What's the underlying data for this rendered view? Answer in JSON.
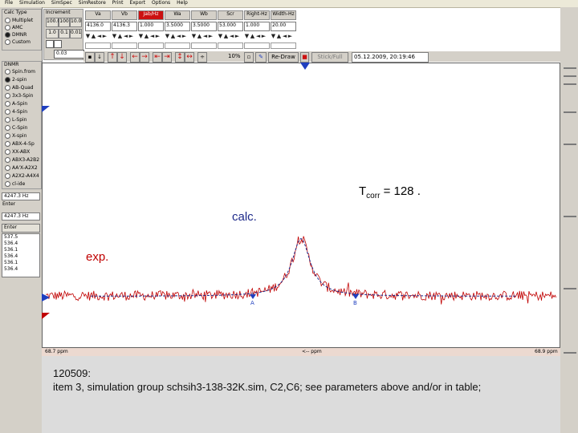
{
  "menu": [
    "File",
    "Simulation",
    "SimSpec",
    "SimRestore",
    "Print",
    "Export",
    "Options",
    "Help"
  ],
  "calc_type": {
    "title": "Calc Type",
    "options": [
      "Multiplet",
      "AMC",
      "DMNR",
      "Custom"
    ],
    "selected": "DMNR"
  },
  "increment": {
    "title": "Increment",
    "buttons": [
      "100.0",
      "100",
      "10.0",
      "1.0",
      "0.1",
      "0.01"
    ],
    "value": "0.03"
  },
  "params": [
    {
      "label": "Va",
      "value": "4136.0",
      "highlight": false
    },
    {
      "label": "Vb",
      "value": "4136.3",
      "highlight": false
    },
    {
      "label": "Jab/Hz",
      "value": "1.000",
      "highlight": true
    },
    {
      "label": "Wa",
      "value": "3.5000",
      "highlight": false
    },
    {
      "label": "Wb",
      "value": "3.5000",
      "highlight": false
    },
    {
      "label": "Scr",
      "value": "53.000",
      "highlight": false
    },
    {
      "label": "Right-Hz",
      "value": "1.000",
      "highlight": false
    },
    {
      "label": "Width-Hz",
      "value": "20.00",
      "highlight": false
    }
  ],
  "toolbar": {
    "zoom": "10%",
    "redraw": "Re-Draw",
    "stick_full": "Stick/Full",
    "timestamp": "05.12.2009, 20:19:46"
  },
  "dnmr": {
    "title": "DNMR",
    "options": [
      "Spin.from",
      "2-spin",
      "AB-Quad",
      "3x3-Spin",
      "A-Spin",
      "4-Spin",
      "L-Spin",
      "C-Spin",
      "X-spin",
      "ABX-4-Sp",
      "XX-ABX",
      "ABX3-A2B2",
      "AA'X-A2X2",
      "A2X2-A4X4",
      "cl-ide"
    ],
    "selected": "2-spin"
  },
  "freq_fields": [
    "4247.3 Hz",
    "4247.3 Hz"
  ],
  "enter_label": "Enter",
  "list_values": [
    "537.5",
    "536.4",
    "536.1",
    "536.4",
    "536.1",
    "536.4"
  ],
  "plot": {
    "tcorr_main": "T",
    "tcorr_sub": "corr",
    "tcorr_value": " = 128 .",
    "calc_label": "calc.",
    "exp_label": "exp.",
    "marker_a": "A",
    "marker_b": "B",
    "axis_left": "68.7 ppm",
    "axis_mid": "<-- ppm",
    "axis_right": "68.9 ppm"
  },
  "notes": {
    "line1": "120509:",
    "line2": "item 3, simulation group schsih3-138-32K.sim,  C2,C6; see parameters above and/or in table;"
  },
  "colors": {
    "experimental": "#c00000",
    "calculated": "#1e2a8a",
    "panel": "#d4d0c8",
    "highlight": "#cc1111",
    "marker": "#1f3fbf"
  }
}
